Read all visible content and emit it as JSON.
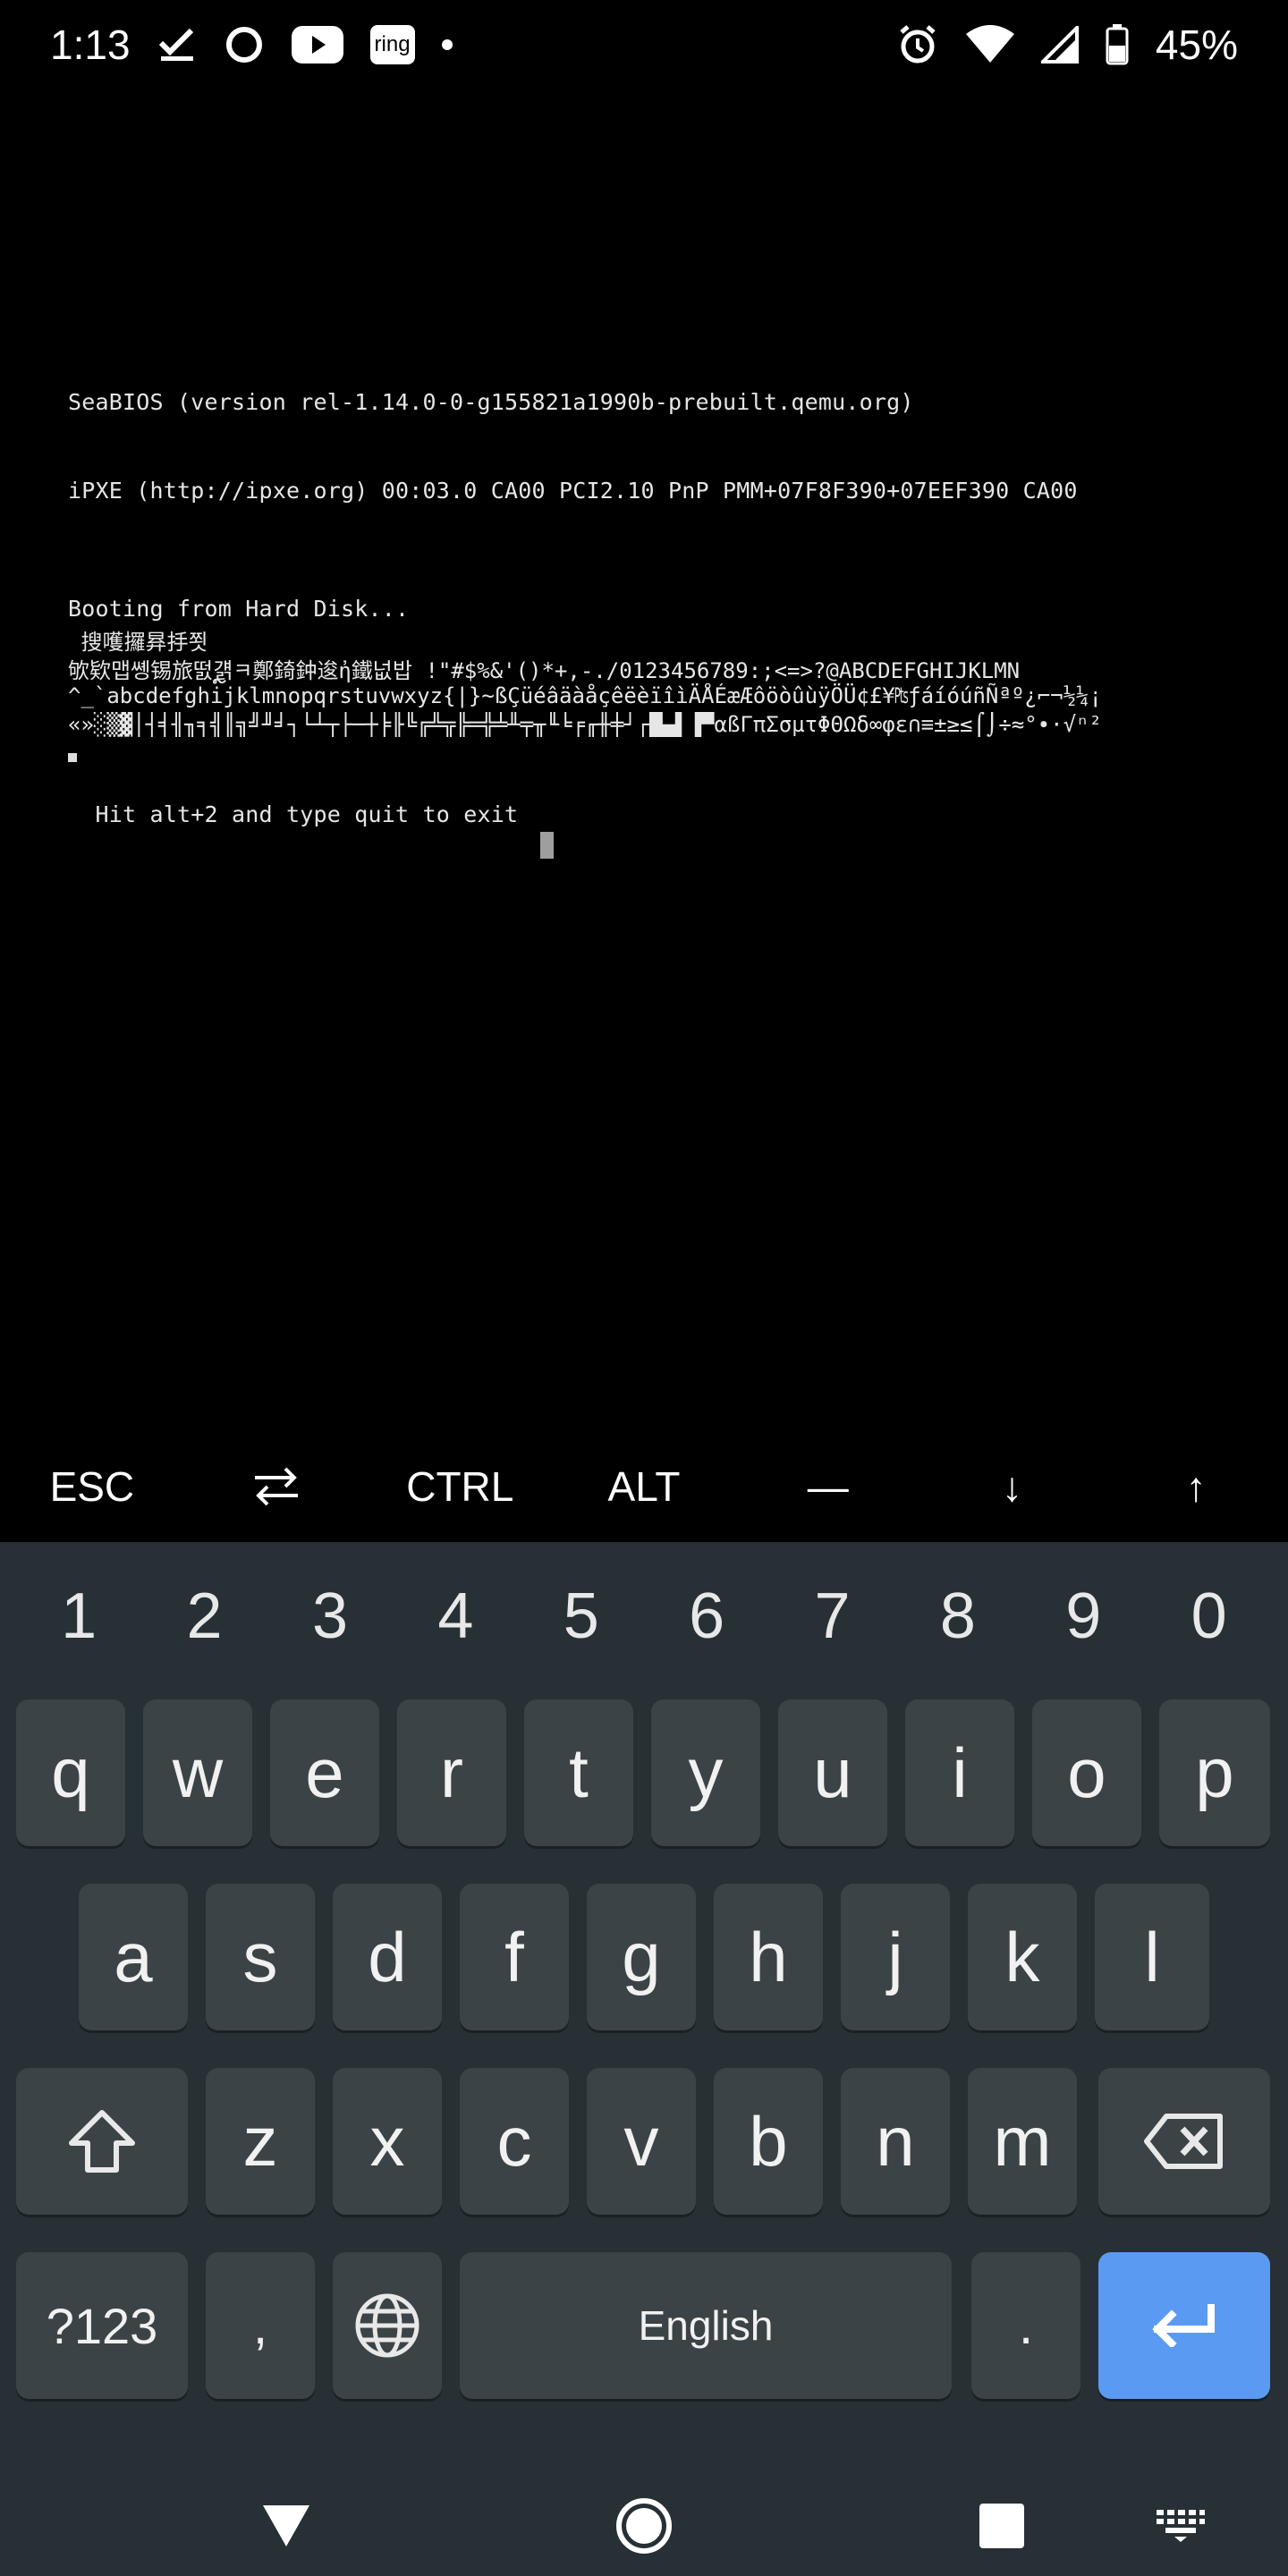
{
  "status_bar": {
    "time": "1:13",
    "ring_badge": "ring",
    "battery_percent": "45%"
  },
  "terminal": {
    "lines": [
      "SeaBIOS (version rel-1.14.0-0-g155821a1990b-prebuilt.qemu.org)",
      "iPXE (http://ipxe.org) 00:03.0 CA00 PCI2.10 PnP PMM+07F8F390+07EEF390 CA00",
      "Booting from Hard Disk...",
      " 搜嚄攞昪抙쬣",
      "欨欵맵쏑锡旅떬ຼ걝ㅋ鄭錡鈡逡ἠ鐵넚밥 !\"#$%&'()*+,-./0123456789:;<=>?@ABCDEFGHIJKLMN",
      "^_`abcdefghijklmnopqrstuvwxyz{|}~ßÇüéâäàåçêëèïîìÄÅÉæÆôöòûùÿÖÜ¢£¥₧ƒáíóúñÑªº¿⌐¬½¼¡",
      "«»░▒▓│┤╡╢╖╕╣║╗╝╜╛┐└┴┬├─┼╞╟╚╔╩╦╠═╬╧╨╤╥╙╘╒╓╫╪┘┌█▄▌▐▀αßΓπΣσµτΦΘΩδ∞φε∩≡±≥≤⌠⌡÷≈°∙·√ⁿ²",
      "  Hit alt+2 and type quit to exit"
    ]
  },
  "extra_keys": [
    {
      "label": "ESC",
      "name": "esc-key"
    },
    {
      "label": "⇄",
      "name": "tab-key"
    },
    {
      "label": "CTRL",
      "name": "ctrl-key"
    },
    {
      "label": "ALT",
      "name": "alt-key"
    },
    {
      "label": "—",
      "name": "dash-key"
    },
    {
      "label": "↓",
      "name": "arrow-down-key"
    },
    {
      "label": "↑",
      "name": "arrow-up-key"
    }
  ],
  "keyboard": {
    "numbers": [
      "1",
      "2",
      "3",
      "4",
      "5",
      "6",
      "7",
      "8",
      "9",
      "0"
    ],
    "row1": [
      "q",
      "w",
      "e",
      "r",
      "t",
      "y",
      "u",
      "i",
      "o",
      "p"
    ],
    "row2": [
      "a",
      "s",
      "d",
      "f",
      "g",
      "h",
      "j",
      "k",
      "l"
    ],
    "row3": [
      "z",
      "x",
      "c",
      "v",
      "b",
      "n",
      "m"
    ],
    "symbols_label": "?123",
    "comma": ",",
    "space_label": "English",
    "period": "."
  },
  "colors": {
    "keyboard_bg": "#263035",
    "key_bg": "#3b4347",
    "enter_bg": "#5b9af2"
  }
}
